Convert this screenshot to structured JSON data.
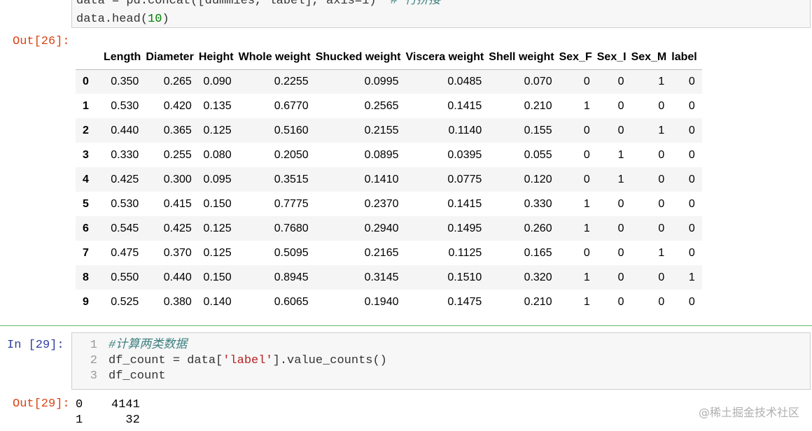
{
  "top_cell": {
    "line1_prefix": "data = pd.concat([dummies, label], axis=1)  ",
    "line1_comment": "# 行拼接",
    "line2_prefix": "data.head(",
    "line2_num": "10",
    "line2_suffix": ")"
  },
  "out26": {
    "prompt": "Out[26]:"
  },
  "dataframe": {
    "columns": [
      "",
      "Length",
      "Diameter",
      "Height",
      "Whole weight",
      "Shucked weight",
      "Viscera weight",
      "Shell weight",
      "Sex_F",
      "Sex_I",
      "Sex_M",
      "label"
    ],
    "rows": [
      [
        "0",
        "0.350",
        "0.265",
        "0.090",
        "0.2255",
        "0.0995",
        "0.0485",
        "0.070",
        "0",
        "0",
        "1",
        "0"
      ],
      [
        "1",
        "0.530",
        "0.420",
        "0.135",
        "0.6770",
        "0.2565",
        "0.1415",
        "0.210",
        "1",
        "0",
        "0",
        "0"
      ],
      [
        "2",
        "0.440",
        "0.365",
        "0.125",
        "0.5160",
        "0.2155",
        "0.1140",
        "0.155",
        "0",
        "0",
        "1",
        "0"
      ],
      [
        "3",
        "0.330",
        "0.255",
        "0.080",
        "0.2050",
        "0.0895",
        "0.0395",
        "0.055",
        "0",
        "1",
        "0",
        "0"
      ],
      [
        "4",
        "0.425",
        "0.300",
        "0.095",
        "0.3515",
        "0.1410",
        "0.0775",
        "0.120",
        "0",
        "1",
        "0",
        "0"
      ],
      [
        "5",
        "0.530",
        "0.415",
        "0.150",
        "0.7775",
        "0.2370",
        "0.1415",
        "0.330",
        "1",
        "0",
        "0",
        "0"
      ],
      [
        "6",
        "0.545",
        "0.425",
        "0.125",
        "0.7680",
        "0.2940",
        "0.1495",
        "0.260",
        "1",
        "0",
        "0",
        "0"
      ],
      [
        "7",
        "0.475",
        "0.370",
        "0.125",
        "0.5095",
        "0.2165",
        "0.1125",
        "0.165",
        "0",
        "0",
        "1",
        "0"
      ],
      [
        "8",
        "0.550",
        "0.440",
        "0.150",
        "0.8945",
        "0.3145",
        "0.1510",
        "0.320",
        "1",
        "0",
        "0",
        "1"
      ],
      [
        "9",
        "0.525",
        "0.380",
        "0.140",
        "0.6065",
        "0.1940",
        "0.1475",
        "0.210",
        "1",
        "0",
        "0",
        "0"
      ]
    ]
  },
  "in29": {
    "prompt": "In  [29]:",
    "line_numbers": [
      "1",
      "2",
      "3"
    ],
    "line1_comment": "#计算两类数据",
    "line2_prefix": "df_count = data[",
    "line2_str": "'label'",
    "line2_suffix": "].value_counts()",
    "line3": "df_count"
  },
  "out29": {
    "prompt": "Out[29]:",
    "line1": "0    4141",
    "line2": "1      32"
  },
  "watermark": "@稀土掘金技术社区"
}
